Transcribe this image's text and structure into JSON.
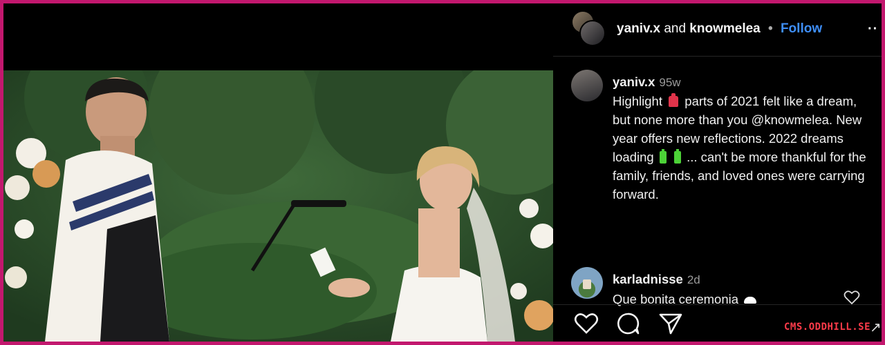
{
  "header": {
    "user1": "yaniv.x",
    "and_text": "and",
    "user2": "knowmelea",
    "separator": "•",
    "follow_label": "Follow",
    "more_label": "··"
  },
  "post": {
    "username": "yaniv.x",
    "age": "95w",
    "caption_part1": "Highlight",
    "caption_part2": "parts of 2021 felt like a dream, but none more than you @knowmelea. New year offers new reflections. 2022 dreams loading",
    "caption_part3": "... can't be more thankful for the family, friends, and loved ones were carrying forward."
  },
  "comment": {
    "username": "karladnisse",
    "age": "2d",
    "text": "Que bonita ceremonia"
  },
  "watermark": "CMS.ODDHILL.SE",
  "corner_mark": "↗",
  "icons": {
    "like": "heart-icon",
    "comment": "comment-bubble-icon",
    "share": "paper-plane-icon",
    "comment_like": "heart-icon"
  },
  "colors": {
    "border": "#c2186e",
    "follow": "#3e8ef7",
    "background": "#000000",
    "watermark": "#ff3b4a"
  }
}
